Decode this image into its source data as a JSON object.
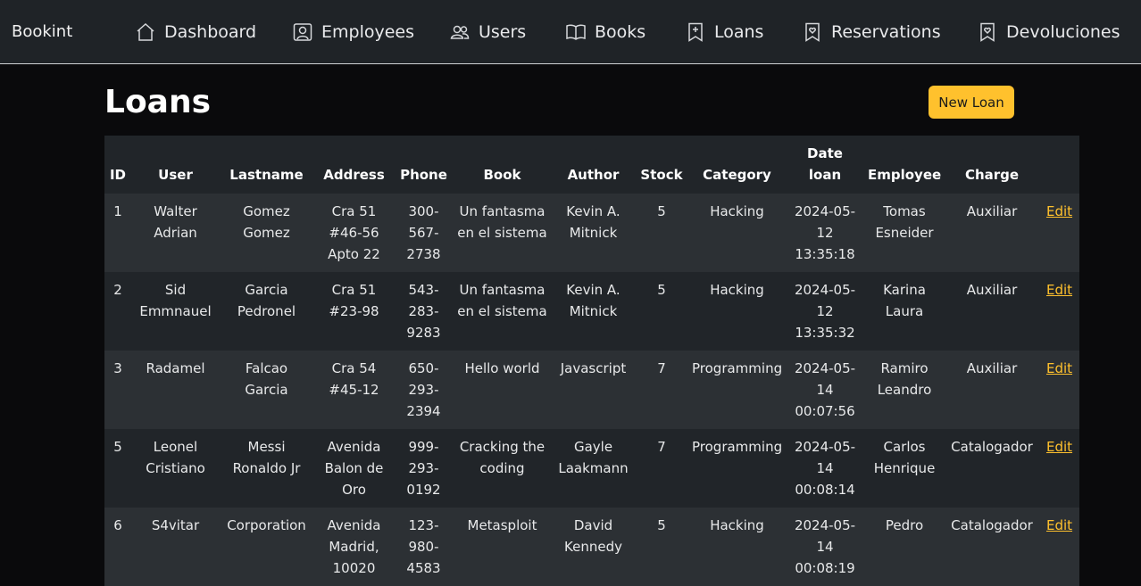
{
  "nav": {
    "brand": "Bookint",
    "items": [
      {
        "label": "Dashboard",
        "icon": "home-icon"
      },
      {
        "label": "Employees",
        "icon": "person-badge-icon"
      },
      {
        "label": "Users",
        "icon": "users-icon"
      },
      {
        "label": "Books",
        "icon": "book-icon"
      },
      {
        "label": "Loans",
        "icon": "bookmark-plus-icon"
      },
      {
        "label": "Reservations",
        "icon": "bookmark-heart-icon"
      },
      {
        "label": "Devoluciones",
        "icon": "bookmark-heart-icon"
      }
    ]
  },
  "page": {
    "title": "Loans",
    "new_button": "New Loan"
  },
  "table": {
    "headers": [
      "ID",
      "User",
      "Lastname",
      "Address",
      "Phone",
      "Book",
      "Author",
      "Stock",
      "Category",
      "Date loan",
      "Employee",
      "Charge",
      ""
    ],
    "rows": [
      {
        "id": "1",
        "user": "Walter Adrian",
        "lastname": "Gomez Gomez",
        "address": "Cra 51 #46-56 Apto 22",
        "phone": "300-567-2738",
        "book": "Un fantasma en el sistema",
        "author": "Kevin A. Mitnick",
        "stock": "5",
        "category": "Hacking",
        "date": "2024-05-12 13:35:18",
        "employee": "Tomas Esneider",
        "charge": "Auxiliar",
        "action": "Edit"
      },
      {
        "id": "2",
        "user": "Sid Emmnauel",
        "lastname": "Garcia Pedronel",
        "address": "Cra 51 #23-98",
        "phone": "543-283-9283",
        "book": "Un fantasma en el sistema",
        "author": "Kevin A. Mitnick",
        "stock": "5",
        "category": "Hacking",
        "date": "2024-05-12 13:35:32",
        "employee": "Karina Laura",
        "charge": "Auxiliar",
        "action": "Edit"
      },
      {
        "id": "3",
        "user": "Radamel",
        "lastname": "Falcao Garcia",
        "address": "Cra 54 #45-12",
        "phone": "650-293-2394",
        "book": "Hello world",
        "author": "Javascript",
        "stock": "7",
        "category": "Programming",
        "date": "2024-05-14 00:07:56",
        "employee": "Ramiro Leandro",
        "charge": "Auxiliar",
        "action": "Edit"
      },
      {
        "id": "5",
        "user": "Leonel Cristiano",
        "lastname": "Messi Ronaldo Jr",
        "address": "Avenida Balon de Oro",
        "phone": "999-293-0192",
        "book": "Cracking the coding",
        "author": "Gayle Laakmann",
        "stock": "7",
        "category": "Programming",
        "date": "2024-05-14 00:08:14",
        "employee": "Carlos Henrique",
        "charge": "Catalogador",
        "action": "Edit"
      },
      {
        "id": "6",
        "user": "S4vitar",
        "lastname": "Corporation",
        "address": "Avenida Madrid, 10020",
        "phone": "123-980-4583",
        "book": "Metasploit",
        "author": "David Kennedy",
        "stock": "5",
        "category": "Hacking",
        "date": "2024-05-14 00:08:19",
        "employee": "Pedro",
        "charge": "Catalogador",
        "action": "Edit"
      }
    ]
  },
  "colors": {
    "accent": "#ffc12d",
    "navbar": "#1f2327",
    "background": "#0a0a0c"
  }
}
